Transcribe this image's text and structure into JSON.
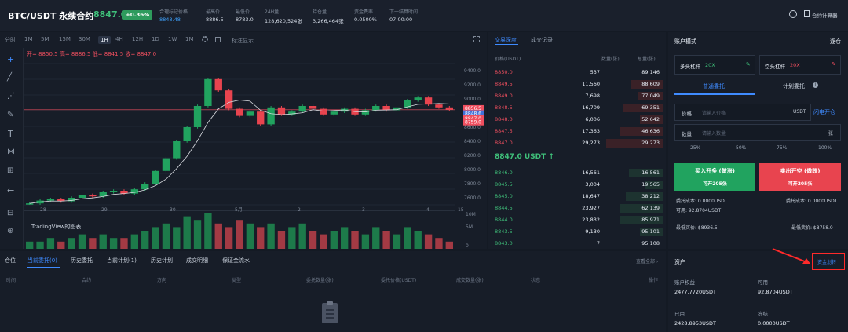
{
  "header": {
    "symbol": "BTC/USDT 永续合约",
    "last_price": "8847.0",
    "change": "+0.36%",
    "stats": [
      {
        "label": "合理标记价格",
        "value": "8848.48",
        "color": "#3fa3ff"
      },
      {
        "label": "最高价",
        "value": "8886.5"
      },
      {
        "label": "最低价",
        "value": "8783.0"
      },
      {
        "label": "24H量",
        "value": "128,620,524张"
      },
      {
        "label": "持仓量",
        "value": "3,266,464张"
      },
      {
        "label": "资金费率",
        "value": "0.0500%"
      },
      {
        "label": "下一结算时间",
        "value": "07:00:00"
      }
    ],
    "calculator_label": "合约计算器"
  },
  "toolbar": {
    "intervals": [
      "分时",
      "1M",
      "5M",
      "15M",
      "30M",
      "1H",
      "4H",
      "12H",
      "1D",
      "1W",
      "1M"
    ],
    "active_index": 5,
    "indicator_label": "标注显示"
  },
  "ohlc": {
    "open": "开= 8850.5",
    "high": "高= 8886.5",
    "low": "低= 8841.5",
    "close": "收= 8847.0"
  },
  "chart": {
    "y_ticks": [
      "9400.0",
      "9200.0",
      "9000.0",
      "8800.0",
      "8600.0",
      "8400.0",
      "8200.0",
      "8000.0",
      "7800.0",
      "7600.0"
    ],
    "x_ticks": [
      "28",
      "29",
      "30",
      "5月",
      "2",
      "3",
      "4",
      "15"
    ],
    "price_tags": [
      {
        "value": "8856.5",
        "color": "#ef4f5f"
      },
      {
        "value": "8848.6",
        "color": "#3f6fd8"
      },
      {
        "value": "8847.0",
        "color": "#ef4f5f"
      },
      {
        "value": "8759.0",
        "color": "#ef4f5f"
      }
    ],
    "volume_ticks": [
      "10M",
      "5M",
      "0"
    ],
    "watermark": "TradingView的图表"
  },
  "chart_data": {
    "type": "candlestick",
    "title": "",
    "close_series": [
      7520,
      7560,
      7580,
      7550,
      7600,
      7640,
      7620,
      7680,
      7700,
      7660,
      7720,
      7800,
      7980,
      8160,
      8400,
      8600,
      8900,
      9280,
      9120,
      8860,
      8760,
      8820,
      8640,
      8880,
      8780,
      8820,
      8900,
      8860,
      8780,
      8820,
      8860,
      8780,
      8840,
      8900,
      8840,
      8880,
      8980,
      9020,
      8920,
      8880,
      8847
    ],
    "volume_series": [
      2,
      2,
      3,
      2,
      3,
      4,
      3,
      4,
      3,
      3,
      4,
      5,
      6,
      7,
      6,
      9,
      8,
      10,
      7,
      6,
      8,
      7,
      6,
      7,
      5,
      6,
      7,
      5,
      4,
      5,
      6,
      5,
      4,
      6,
      5,
      4,
      6,
      5,
      4,
      3,
      2
    ],
    "ylim": [
      7500,
      9500
    ]
  },
  "orderbook": {
    "tabs": [
      "交易深度",
      "成交记录"
    ],
    "headers": [
      "价格(USDT)",
      "数量(张)",
      "总量(张)"
    ],
    "asks": [
      {
        "price": "8850.0",
        "qty": "537",
        "total": "89,146",
        "depth": 0
      },
      {
        "price": "8849.5",
        "qty": "11,560",
        "total": "88,609",
        "depth": 0.55
      },
      {
        "price": "8849.0",
        "qty": "7,698",
        "total": "77,049",
        "depth": 0.45
      },
      {
        "price": "8848.5",
        "qty": "16,709",
        "total": "69,351",
        "depth": 0.7
      },
      {
        "price": "8848.0",
        "qty": "6,006",
        "total": "52,642",
        "depth": 0.4
      },
      {
        "price": "8847.5",
        "qty": "17,363",
        "total": "46,636",
        "depth": 0.75
      },
      {
        "price": "8847.0",
        "qty": "29,273",
        "total": "29,273",
        "depth": 1
      }
    ],
    "mid_price": "8847.0 USDT",
    "bids": [
      {
        "price": "8846.0",
        "qty": "16,561",
        "total": "16,561",
        "depth": 0.6
      },
      {
        "price": "8845.5",
        "qty": "3,004",
        "total": "19,565",
        "depth": 0.3
      },
      {
        "price": "8845.0",
        "qty": "18,647",
        "total": "38,212",
        "depth": 0.65
      },
      {
        "price": "8844.5",
        "qty": "23,927",
        "total": "62,139",
        "depth": 0.75
      },
      {
        "price": "8844.0",
        "qty": "23,832",
        "total": "85,971",
        "depth": 0.75
      },
      {
        "price": "8843.5",
        "qty": "9,130",
        "total": "95,101",
        "depth": 0.4
      },
      {
        "price": "8843.0",
        "qty": "7",
        "total": "95,108",
        "depth": 0
      }
    ]
  },
  "trade": {
    "mode_label": "账户模式",
    "mode_value": "逐仓",
    "long_leverage": "多头杠杆",
    "long_value": "20X",
    "short_leverage": "空头杠杆",
    "short_value": "20X",
    "tab_limit": "普通委托",
    "tab_plan": "计划委托",
    "price_label": "价格",
    "price_placeholder": "请输入价格",
    "price_unit": "USDT",
    "flash_label": "闪电开仓",
    "qty_label": "数量",
    "qty_placeholder": "请输入数量",
    "qty_unit": "张",
    "percents": [
      "25%",
      "50%",
      "75%",
      "100%"
    ],
    "buy_label": "买入开多 (做涨)",
    "buy_sub": "可开205张",
    "sell_label": "卖出开空 (做跌)",
    "sell_sub": "可开205张",
    "cost_buy": "委托成本: 0.0000USDT",
    "cost_sell": "委托成本: 0.0000USDT",
    "available": "可用: 92.8704USDT",
    "max_buy": "最低买价: $8936.5",
    "max_sell": "最低卖价: $8758.0"
  },
  "bottom": {
    "tabs": [
      "仓位",
      "当前委托(0)",
      "历史委托",
      "当前计划(1)",
      "历史计划",
      "成交明细",
      "保证金流水"
    ],
    "active_tab": 1,
    "view_all": "查看全部",
    "columns": [
      "时间",
      "合约",
      "方向",
      "类型",
      "委托数量(张)",
      "委托价格(USDT)",
      "成交数量(张)",
      "状态",
      "操作"
    ]
  },
  "assets": {
    "title": "资产",
    "transfer_label": "资金划转",
    "equity_label": "账户权益",
    "equity_value": "2477.7720USDT",
    "available_label": "可用",
    "available_value": "92.8704USDT",
    "used_label": "已用",
    "used_value": "2428.8953USDT",
    "frozen_label": "冻结",
    "frozen_value": "0.0000USDT"
  }
}
